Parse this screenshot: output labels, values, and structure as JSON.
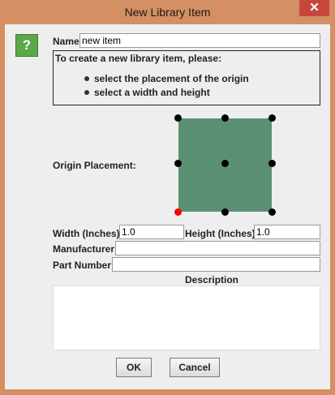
{
  "window": {
    "title": "New Library Item",
    "close_glyph": "✕"
  },
  "help_icon": {
    "glyph": "?"
  },
  "name": {
    "label": "Name",
    "value": "new item"
  },
  "instructions": {
    "heading": "To create a new library item, please:",
    "bullets": [
      "select the placement of the origin",
      "select a width and height"
    ]
  },
  "origin": {
    "label": "Origin Placement:",
    "selected": "bottom-left",
    "box_color": "#5b8f74",
    "selected_color": "#ff0000"
  },
  "width": {
    "label": "Width (Inches)",
    "value": "1.0"
  },
  "height": {
    "label": "Height (Inches)",
    "value": "1.0"
  },
  "manufacturer": {
    "label": "Manufacturer",
    "value": ""
  },
  "part_number": {
    "label": "Part Number",
    "value": ""
  },
  "description": {
    "label": "Description",
    "value": ""
  },
  "buttons": {
    "ok": "OK",
    "cancel": "Cancel"
  }
}
